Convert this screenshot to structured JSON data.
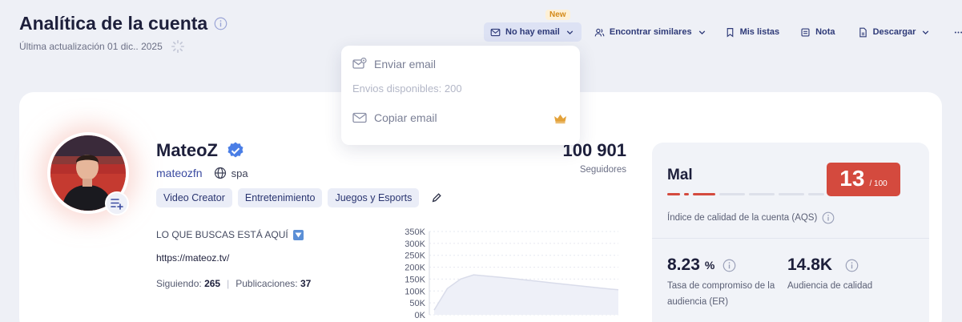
{
  "header": {
    "title": "Analítica de la cuenta",
    "updated": "Última actualización 01 dic.. 2025"
  },
  "toolbar": {
    "new_badge": "New",
    "email": "No hay email",
    "similar": "Encontrar similares",
    "lists": "Mis listas",
    "note": "Nota",
    "download": "Descargar"
  },
  "dropdown": {
    "send_email": "Enviar email",
    "available": "Envios disponibles: 200",
    "copy_email": "Copiar email"
  },
  "profile": {
    "name": "MateoZ",
    "handle": "mateozfn",
    "language": "spa",
    "tags": [
      "Video Creator",
      "Entretenimiento",
      "Juegos y Esports"
    ],
    "bio": "LO QUE BUSCAS ESTÁ AQUÍ",
    "link": "https://mateoz.tv/",
    "following_label": "Siguiendo:",
    "following": "265",
    "posts_label": "Publicaciones:",
    "posts": "37",
    "followers": "100 901",
    "followers_label": "Seguidores"
  },
  "quality": {
    "label": "Mal",
    "score": "13",
    "score_max": "/ 100",
    "level": 0.13,
    "aqs_label": "Índice de calidad de la cuenta (AQS)",
    "er_value": "8.23",
    "er_unit": "%",
    "er_label": "Tasa de compromiso de la audiencia (ER)",
    "audience_value": "14.8K",
    "audience_label": "Audiencia de calidad"
  },
  "colors": {
    "accent": "#2e3a78",
    "bad": "#d44a3e",
    "crown": "#e3a23a"
  },
  "chart_data": {
    "type": "area",
    "ytick_labels": [
      "350K",
      "300K",
      "250K",
      "200K",
      "150K",
      "100K",
      "50K",
      "0K"
    ],
    "ylim": [
      0,
      350000
    ],
    "values": [
      20000,
      110000,
      150000,
      168000,
      163000,
      158000,
      152000,
      146000,
      140000,
      134000,
      128000,
      122000,
      116000,
      110000,
      105000
    ]
  }
}
